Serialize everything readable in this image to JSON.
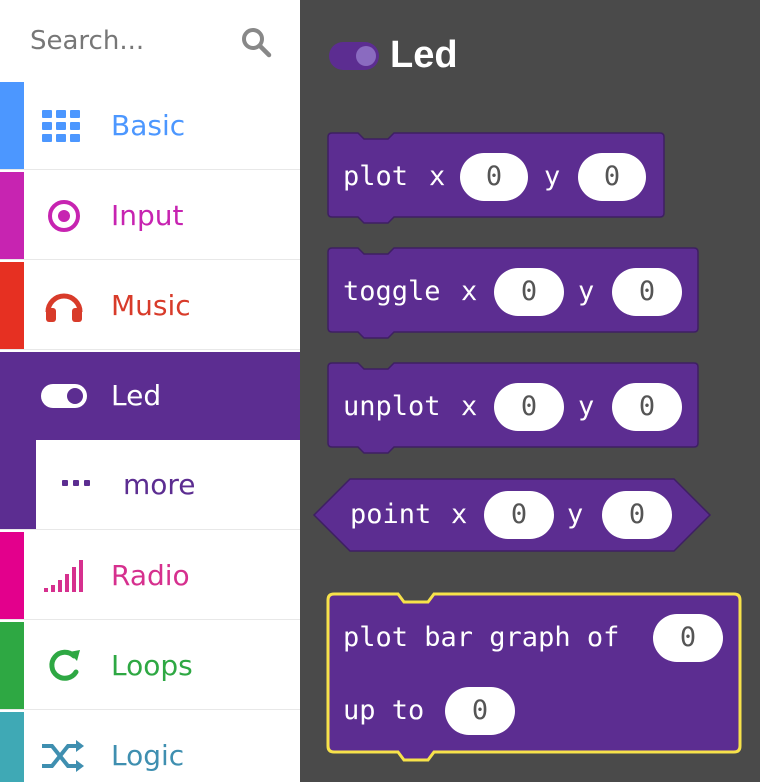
{
  "search": {
    "placeholder": "Search..."
  },
  "categories": [
    {
      "label": "Basic",
      "color": "#4c97ff",
      "icon": "grid-icon"
    },
    {
      "label": "Input",
      "color": "#c724b1",
      "icon": "target-icon"
    },
    {
      "label": "Music",
      "color": "#e63022",
      "icon": "headphones-icon"
    },
    {
      "label": "Led",
      "color": "#5c2d91",
      "icon": "toggle-icon"
    },
    {
      "label": "more",
      "color": "#5c2d91",
      "icon": "more-dots-icon"
    },
    {
      "label": "Radio",
      "color": "#e3008c",
      "icon": "signal-bars-icon"
    },
    {
      "label": "Loops",
      "color": "#00a65c",
      "icon": "loop-icon"
    },
    {
      "label": "Logic",
      "color": "#00a4a6",
      "icon": "shuffle-icon"
    }
  ],
  "flyout": {
    "title": "Led",
    "blocks": [
      {
        "label": "plot",
        "x_label": "x",
        "x": "0",
        "y_label": "y",
        "y": "0"
      },
      {
        "label": "toggle",
        "x_label": "x",
        "x": "0",
        "y_label": "y",
        "y": "0"
      },
      {
        "label": "unplot",
        "x_label": "x",
        "x": "0",
        "y_label": "y",
        "y": "0"
      },
      {
        "label": "point",
        "x_label": "x",
        "x": "0",
        "y_label": "y",
        "y": "0"
      }
    ],
    "bar_graph": {
      "line1": "plot bar graph of",
      "value": "0",
      "line2": "up to",
      "max": "0"
    }
  }
}
